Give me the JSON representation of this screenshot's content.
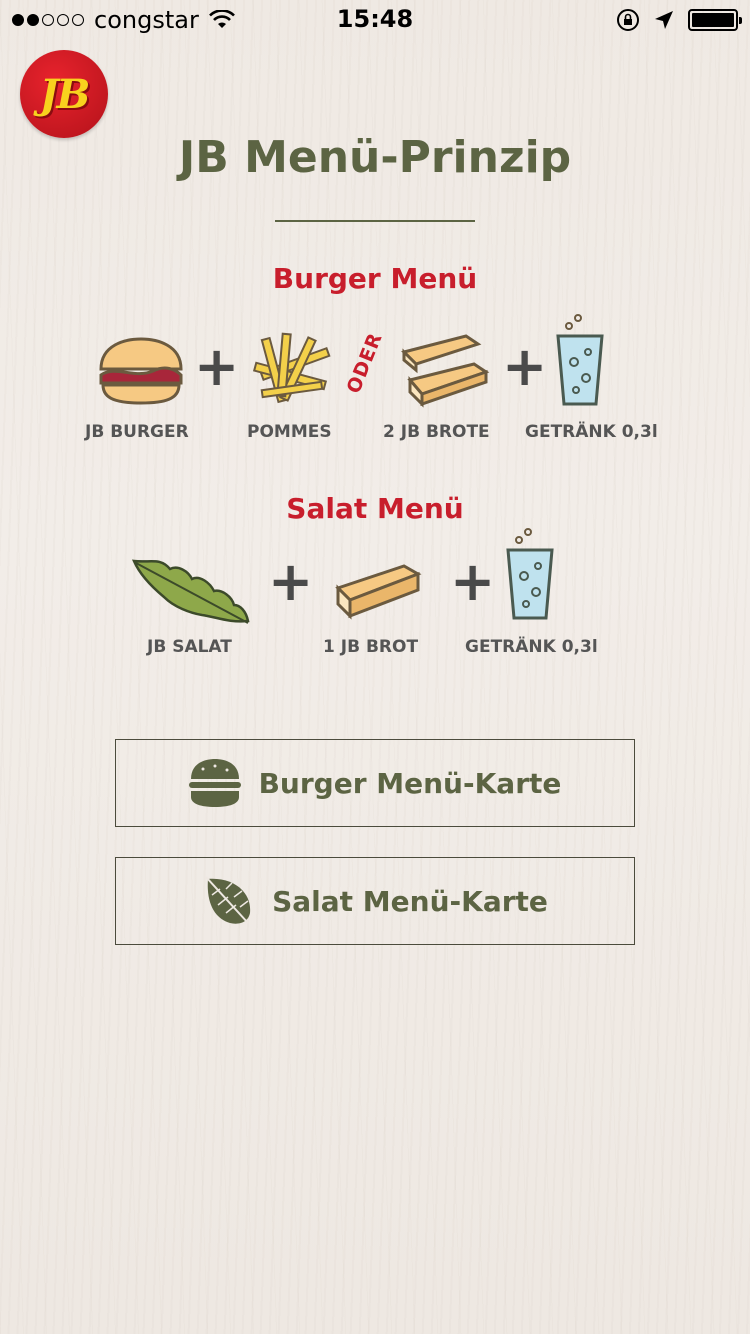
{
  "status_bar": {
    "carrier": "congstar",
    "time": "15:48"
  },
  "header": {
    "logo_text": "JB",
    "title": "JB Menü-Prinzip"
  },
  "burger_menu": {
    "title": "Burger Menü",
    "items": [
      {
        "label": "JB BURGER",
        "icon": "burger-icon"
      },
      {
        "label": "POMMES",
        "icon": "fries-icon"
      },
      {
        "label": "2 JB BROTE",
        "icon": "bread-icon"
      },
      {
        "label": "GETRÄNK 0,3l",
        "icon": "drink-icon"
      }
    ],
    "or_label": "ODER"
  },
  "salad_menu": {
    "title": "Salat Menü",
    "items": [
      {
        "label": "JB SALAT",
        "icon": "salad-leaf-icon"
      },
      {
        "label": "1 JB BROT",
        "icon": "bread-icon"
      },
      {
        "label": "GETRÄNK 0,3l",
        "icon": "drink-icon"
      }
    ]
  },
  "buttons": {
    "burger_card": "Burger Menü-Karte",
    "salad_card": "Salat Menü-Karte"
  },
  "colors": {
    "accent_red": "#c81e2c",
    "olive": "#5c6443"
  }
}
